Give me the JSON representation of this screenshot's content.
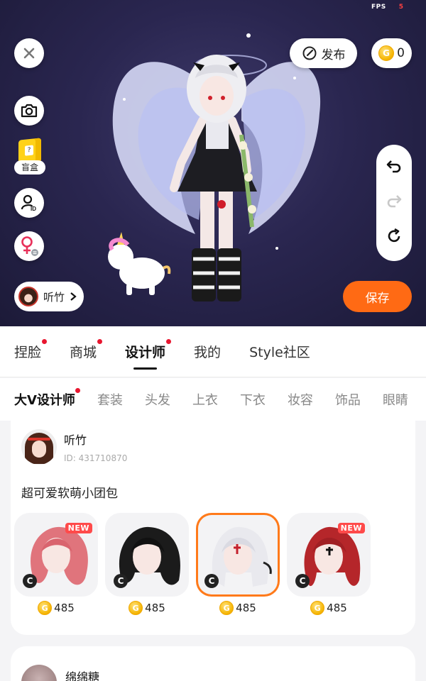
{
  "status": {
    "fps_label": "FPS",
    "fps_value": "5"
  },
  "top_bar": {
    "publish_label": "发布",
    "coin_balance": "0"
  },
  "left_tools": {
    "blindbox_label": "盲盒",
    "author_name": "听竹"
  },
  "actions": {
    "save_label": "保存"
  },
  "main_tabs": [
    {
      "label": "捏脸",
      "dot": true
    },
    {
      "label": "商城",
      "dot": true
    },
    {
      "label": "设计师",
      "dot": true,
      "active": true
    },
    {
      "label": "我的",
      "dot": false
    },
    {
      "label": "Style社区",
      "dot": false
    }
  ],
  "sub_tabs": [
    {
      "label": "大V设计师",
      "dot": true,
      "active": true
    },
    {
      "label": "套装"
    },
    {
      "label": "头发"
    },
    {
      "label": "上衣"
    },
    {
      "label": "下衣"
    },
    {
      "label": "妆容"
    },
    {
      "label": "饰品"
    },
    {
      "label": "眼睛"
    }
  ],
  "designers": [
    {
      "name": "听竹",
      "id_text": "ID: 431710870",
      "description": "超可爱软萌小团包",
      "items": [
        {
          "price": "485",
          "new_label": "NEW",
          "hair_color": "#e0747c",
          "selected": false
        },
        {
          "price": "485",
          "new_label": "",
          "hair_color": "#1b1b1b",
          "selected": false
        },
        {
          "price": "485",
          "new_label": "",
          "hair_color": "#e9e9ee",
          "selected": true
        },
        {
          "price": "485",
          "new_label": "NEW",
          "hair_color": "#b5262a",
          "selected": false
        }
      ]
    },
    {
      "name": "绵绵糖"
    }
  ],
  "colors": {
    "accent": "#ff6a14",
    "dot": "#e8162f",
    "stage_bg": "#2a2650"
  },
  "icons": [
    "close-icon",
    "camera-icon",
    "id-icon",
    "gender-female-icon",
    "publish-icon",
    "coin-icon",
    "undo-icon",
    "redo-icon",
    "reset-icon",
    "copyright-icon",
    "chevron-right-icon"
  ]
}
